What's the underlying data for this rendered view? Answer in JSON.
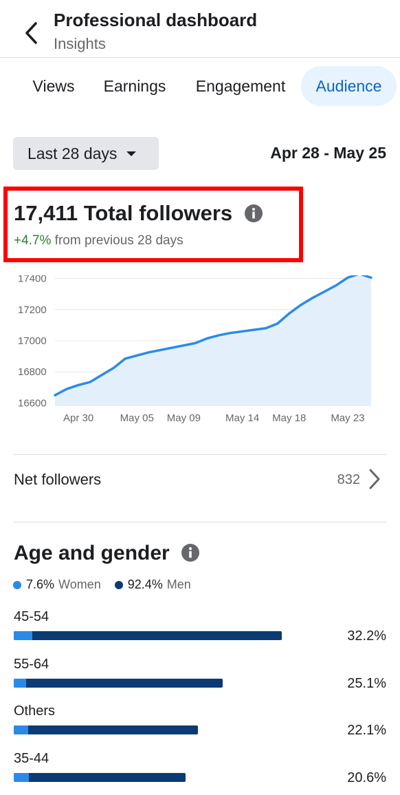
{
  "header": {
    "title": "Professional dashboard",
    "subtitle": "Insights",
    "back_icon": "chevron-left-icon"
  },
  "tabs": [
    {
      "label": "Views",
      "active": false
    },
    {
      "label": "Earnings",
      "active": false
    },
    {
      "label": "Engagement",
      "active": false
    },
    {
      "label": "Audience",
      "active": true
    }
  ],
  "filter": {
    "range_label": "Last 28 days",
    "date_range": "Apr 28 - May 25"
  },
  "followers": {
    "total_text": "17,411 Total followers",
    "change": "+4.7%",
    "change_suffix": " from previous 28 days"
  },
  "chart_data": {
    "type": "area",
    "title": "",
    "xlabel": "",
    "ylabel": "",
    "x_tick_labels": [
      "Apr 30",
      "May 05",
      "May 09",
      "May 14",
      "May 18",
      "May 23"
    ],
    "y_tick_labels": [
      "17400",
      "17200",
      "17000",
      "16800",
      "16600"
    ],
    "ylim": [
      16580,
      17420
    ],
    "grid": true,
    "color": "#2b8ae8",
    "fill": "#e3f0fc",
    "series": [
      {
        "x": [
          "Apr 28",
          "Apr 29",
          "Apr 30",
          "May 01",
          "May 02",
          "May 03",
          "May 04",
          "May 05",
          "May 06",
          "May 07",
          "May 08",
          "May 09",
          "May 10",
          "May 11",
          "May 12",
          "May 13",
          "May 14",
          "May 15",
          "May 16",
          "May 17",
          "May 18",
          "May 19",
          "May 20",
          "May 21",
          "May 22",
          "May 23",
          "May 24",
          "May 25"
        ],
        "values": [
          16650,
          16690,
          16715,
          16735,
          16780,
          16825,
          16885,
          16905,
          16925,
          16940,
          16955,
          16970,
          16985,
          17015,
          17035,
          17050,
          17060,
          17070,
          17080,
          17110,
          17175,
          17230,
          17275,
          17315,
          17355,
          17405,
          17430,
          17405
        ]
      }
    ]
  },
  "net_followers": {
    "label": "Net followers",
    "value": "832"
  },
  "age_gender": {
    "title": "Age and gender",
    "women_pct": "7.6%",
    "women_label": "Women",
    "men_pct": "92.4%",
    "men_label": "Men",
    "women_color": "#2b8ae8",
    "men_color": "#0a3b73",
    "groups": [
      {
        "label": "45-54",
        "pct": "32.2%",
        "share": 32.2,
        "women_fraction": 0.07
      },
      {
        "label": "55-64",
        "pct": "25.1%",
        "share": 25.1,
        "women_fraction": 0.06
      },
      {
        "label": "Others",
        "pct": "22.1%",
        "share": 22.1,
        "women_fraction": 0.08
      },
      {
        "label": "35-44",
        "pct": "20.6%",
        "share": 20.6,
        "women_fraction": 0.09
      }
    ]
  }
}
